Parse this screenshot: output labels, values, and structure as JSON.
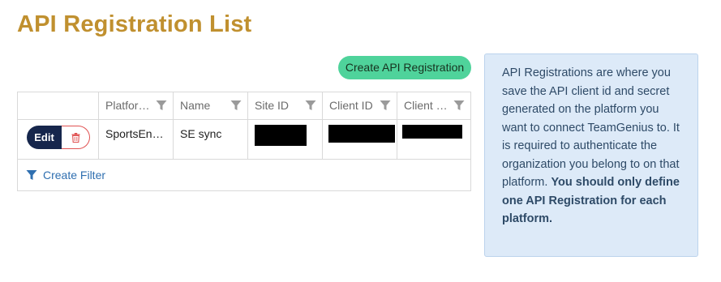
{
  "page": {
    "title": "API Registration List",
    "title_color": "#c0902f"
  },
  "toolbar": {
    "create_label": "Create API Registration",
    "create_color": "#4fd39b"
  },
  "table": {
    "columns": [
      {
        "label": "Platfor…",
        "icon": "filter-icon"
      },
      {
        "label": "Name",
        "icon": "filter-icon"
      },
      {
        "label": "Site ID",
        "icon": "filter-icon"
      },
      {
        "label": "Client ID",
        "icon": "filter-icon"
      },
      {
        "label": "Client …",
        "icon": "filter-icon"
      }
    ],
    "rows": [
      {
        "edit_label": "Edit",
        "delete_icon": "trash-icon",
        "platform": "SportsEn…",
        "name": "SE sync",
        "site_id": "[redacted]",
        "client_id": "[redacted]",
        "client_secret": "[redacted]"
      }
    ],
    "create_filter_label": "Create Filter"
  },
  "info": {
    "text": "API Registrations are where you save the API client id and secret generated on the platform you want to connect TeamGenius to. It is required to authenticate the organization you belong to on that platform.",
    "bold_text": "You should only define one API Registration for each platform."
  },
  "colors": {
    "edit_button": "#16264c",
    "delete_border": "#e05252",
    "link": "#2f6fb0",
    "info_background": "#ddeaf8"
  }
}
